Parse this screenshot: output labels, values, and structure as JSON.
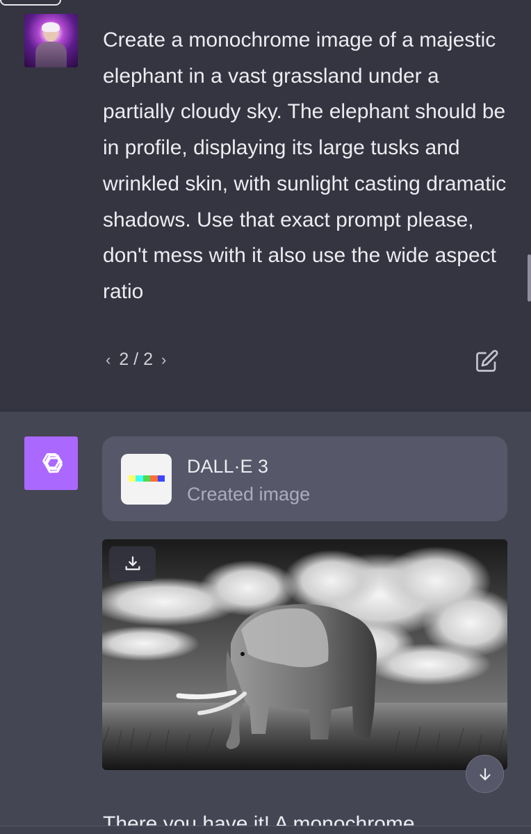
{
  "user_message": {
    "text": "Create a monochrome image of a majestic elephant in a vast grassland under a partially cloudy sky. The elephant should be in profile, displaying its large tusks and wrinkled skin, with sunlight casting dramatic shadows. Use that exact prompt please, don't mess with it also use the wide aspect ratio",
    "pager": {
      "prev": "‹",
      "label": "2 / 2",
      "next": "›"
    }
  },
  "assistant": {
    "tool": {
      "title": "DALL·E 3",
      "subtitle": "Created image"
    },
    "image": {
      "alt": "monochrome elephant in grassland under cloudy sky"
    },
    "reply_start": "There you have it! A monochrome"
  },
  "icons": {
    "edit": "edit-icon",
    "download": "download-icon",
    "scroll_down": "arrow-down-icon",
    "openai": "openai-logo-icon"
  },
  "colors": {
    "user_bg": "#343541",
    "assistant_bg": "#444654",
    "gpt_avatar": "#ab68ff",
    "card": "#565869"
  }
}
